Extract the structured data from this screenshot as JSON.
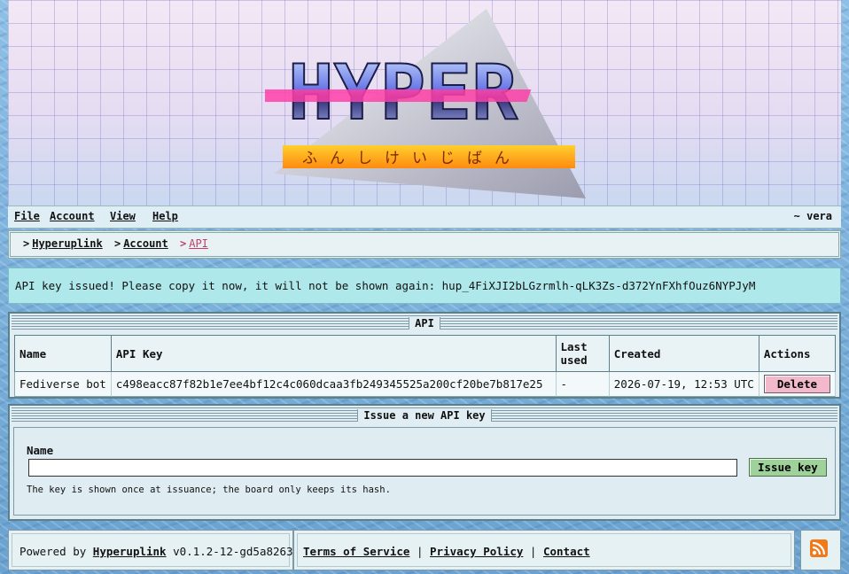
{
  "logo": {
    "text": "HYPER",
    "subtitle": "ふんしけいじばん"
  },
  "menu": {
    "items": [
      {
        "label": "File"
      },
      {
        "label": "Account"
      },
      {
        "label": "View"
      },
      {
        "label": "Help"
      }
    ],
    "user": "~ vera"
  },
  "breadcrumb": {
    "items": [
      {
        "label": "Hyperuplink"
      },
      {
        "label": "Account"
      }
    ],
    "current": "API"
  },
  "notice": {
    "text": "API key issued! Please copy it now, it will not be shown again: hup_4FiXJI2bLGzrmlh-qLK3Zs-d372YnFXhfOuz6NYPJyM"
  },
  "api_panel": {
    "title": "API",
    "columns": [
      "Name",
      "API Key",
      "Last used",
      "Created",
      "Actions"
    ],
    "rows": [
      {
        "name": "Fediverse bot",
        "key": "c498eacc87f82b1e7ee4bf12c4c060dcaa3fb249345525a200cf20be7b817e25",
        "last_used": "-",
        "created": "2026-07-19, 12:53 UTC",
        "action": "Delete"
      }
    ]
  },
  "issue_panel": {
    "title": "Issue a new API key",
    "name_label": "Name",
    "name_value": "",
    "button": "Issue key",
    "hint": "The key is shown once at issuance; the board only keeps its hash."
  },
  "footer": {
    "powered_prefix": "Powered by",
    "powered_link": "Hyperuplink",
    "version": "v0.1.2-12-gd5a8263",
    "links": [
      {
        "label": "Terms of Service"
      },
      {
        "label": "Privacy Policy"
      },
      {
        "label": "Contact"
      }
    ],
    "separator": "|"
  },
  "colors": {
    "accent_pink": "#c0406a",
    "notice_bg": "#aee8ea",
    "delete_bg": "#f2b8cc",
    "issue_bg": "#9fd29a",
    "rss": "#f07a1a"
  },
  "icons": {
    "rss": "rss-feed-icon"
  }
}
